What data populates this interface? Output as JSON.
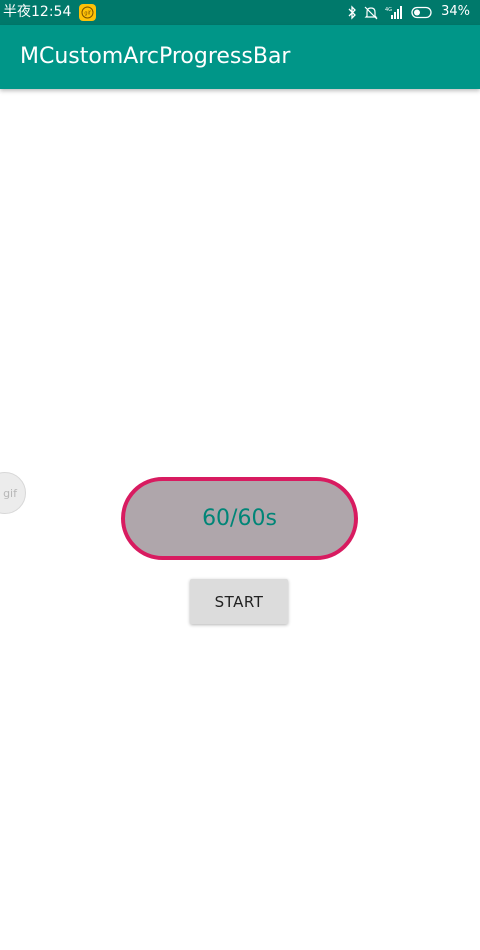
{
  "status_bar": {
    "time": "半夜12:54",
    "battery_percent": "34%",
    "notification_icon": "gif-icon",
    "icons": [
      "bluetooth-icon",
      "mute-icon",
      "signal-icon",
      "battery-icon"
    ],
    "battery_level": 0.34
  },
  "app_bar": {
    "title": "MCustomArcProgressBar",
    "color": "#009688"
  },
  "floating": {
    "label": "gif"
  },
  "progress": {
    "text": "60/60s",
    "current": 60,
    "max": 60,
    "arc_color": "#d81b60",
    "text_color": "#008577"
  },
  "controls": {
    "start_label": "START"
  }
}
